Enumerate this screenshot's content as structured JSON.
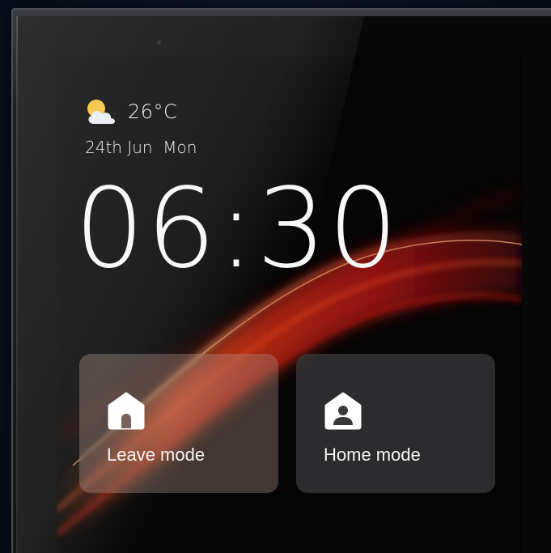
{
  "weather": {
    "icon": "partly-cloudy-icon",
    "temperature": "26°C",
    "date": "24th Jun  Mon"
  },
  "clock": {
    "time": "06:30"
  },
  "modes": [
    {
      "label": "Leave mode",
      "icon": "house-empty-icon"
    },
    {
      "label": "Home mode",
      "icon": "house-person-icon"
    }
  ],
  "colors": {
    "accent_wave": "#ff4a1c",
    "tile_leave": "#aa8c82",
    "tile_home": "#3c3c3e",
    "text": "#f4f4f4"
  }
}
